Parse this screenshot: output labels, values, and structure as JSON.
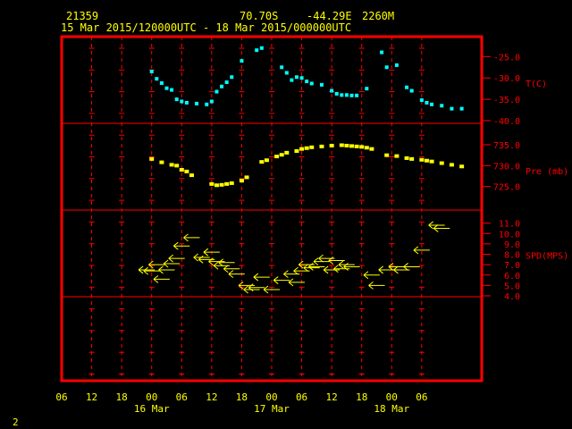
{
  "header": {
    "station_id": "21359",
    "lat": "70.70S",
    "lon": "-44.29E",
    "elevation": "2260M",
    "date_range": "15 Mar 2015/120000UTC - 18 Mar 2015/000000UTC"
  },
  "page_number": "2",
  "colors": {
    "frame": "#ff0000",
    "text": "#ffff00",
    "temp": "#00ffff",
    "pressure": "#ffff00",
    "wind": "#ffff00",
    "grid": "#ff0000",
    "axis_labels": "#ff0000"
  },
  "chart_data": [
    {
      "type": "scatter",
      "name": "T(C)",
      "ylabel": "T(C)",
      "ylim": [
        -40,
        -22
      ],
      "ticks": [
        "-25.0",
        "-30.0",
        "-35.0",
        "-40.0"
      ],
      "points": [
        [
          12,
          -28.5
        ],
        [
          13,
          -30.2
        ],
        [
          14,
          -31.2
        ],
        [
          15,
          -32.4
        ],
        [
          16,
          -32.8
        ],
        [
          17,
          -35.0
        ],
        [
          18,
          -35.5
        ],
        [
          19,
          -35.8
        ],
        [
          21,
          -36.0
        ],
        [
          23,
          -36.2
        ],
        [
          24,
          -35.5
        ],
        [
          25,
          -33.2
        ],
        [
          26,
          -32.0
        ],
        [
          27,
          -31.0
        ],
        [
          28,
          -29.8
        ],
        [
          30,
          -26.0
        ],
        [
          33,
          -23.5
        ],
        [
          34,
          -23.0
        ],
        [
          38,
          -27.5
        ],
        [
          39,
          -28.8
        ],
        [
          40,
          -30.5
        ],
        [
          41,
          -29.8
        ],
        [
          42,
          -30.0
        ],
        [
          43,
          -30.8
        ],
        [
          44,
          -31.3
        ],
        [
          46,
          -31.6
        ],
        [
          48,
          -33.0
        ],
        [
          49,
          -33.7
        ],
        [
          50,
          -34.0
        ],
        [
          51,
          -34.0
        ],
        [
          52,
          -34.1
        ],
        [
          53,
          -34.1
        ],
        [
          55,
          -32.5
        ],
        [
          58,
          -24.0
        ],
        [
          59,
          -27.5
        ],
        [
          61,
          -27.0
        ],
        [
          63,
          -32.2
        ],
        [
          64,
          -33.0
        ],
        [
          66,
          -35.2
        ],
        [
          67,
          -35.8
        ],
        [
          68,
          -36.2
        ],
        [
          70,
          -36.5
        ],
        [
          72,
          -37.2
        ],
        [
          74,
          -37.2
        ]
      ]
    },
    {
      "type": "scatter",
      "name": "Pre (mb)",
      "ylabel": "Pre (mb)",
      "ylim": [
        720,
        738
      ],
      "ticks": [
        "735.0",
        "730.0",
        "725.0"
      ],
      "points": [
        [
          12,
          731.6
        ],
        [
          14,
          730.8
        ],
        [
          16,
          730.2
        ],
        [
          17,
          730.0
        ],
        [
          18,
          729.0
        ],
        [
          19,
          728.6
        ],
        [
          20,
          727.7
        ],
        [
          24,
          725.6
        ],
        [
          25,
          725.3
        ],
        [
          26,
          725.4
        ],
        [
          27,
          725.6
        ],
        [
          28,
          725.8
        ],
        [
          30,
          726.4
        ],
        [
          31,
          727.2
        ],
        [
          34,
          730.9
        ],
        [
          35,
          731.3
        ],
        [
          37,
          732.2
        ],
        [
          38,
          732.6
        ],
        [
          39,
          733.1
        ],
        [
          41,
          733.5
        ],
        [
          42,
          734.0
        ],
        [
          43,
          734.2
        ],
        [
          44,
          734.4
        ],
        [
          46,
          734.6
        ],
        [
          48,
          734.8
        ],
        [
          50,
          734.9
        ],
        [
          51,
          734.8
        ],
        [
          52,
          734.7
        ],
        [
          53,
          734.6
        ],
        [
          54,
          734.5
        ],
        [
          55,
          734.3
        ],
        [
          56,
          734.0
        ],
        [
          59,
          732.5
        ],
        [
          61,
          732.3
        ],
        [
          63,
          731.8
        ],
        [
          64,
          731.6
        ],
        [
          66,
          731.4
        ],
        [
          67,
          731.2
        ],
        [
          68,
          731.0
        ],
        [
          70,
          730.6
        ],
        [
          72,
          730.2
        ],
        [
          74,
          729.8
        ]
      ]
    },
    {
      "type": "scatter",
      "name": "SPD(MPS)",
      "ylabel": "SPD(MPS)",
      "ylim": [
        4,
        12
      ],
      "ticks": [
        "11.0",
        "10.0",
        "9.0",
        "8.0",
        "7.0",
        "6.0",
        "5.0",
        "4.0"
      ],
      "points": [
        [
          11,
          6.5
        ],
        [
          12,
          6.4
        ],
        [
          13,
          7.0
        ],
        [
          14,
          5.6
        ],
        [
          15,
          6.5
        ],
        [
          16,
          7.1
        ],
        [
          17,
          7.6
        ],
        [
          18,
          8.8
        ],
        [
          20,
          9.6
        ],
        [
          22,
          7.7
        ],
        [
          23,
          7.5
        ],
        [
          24,
          8.2
        ],
        [
          25,
          7.3
        ],
        [
          26,
          6.9
        ],
        [
          27,
          7.2
        ],
        [
          28,
          6.6
        ],
        [
          29,
          6.1
        ],
        [
          31,
          5.0
        ],
        [
          32,
          4.6
        ],
        [
          33,
          4.8
        ],
        [
          34,
          5.8
        ],
        [
          36,
          4.6
        ],
        [
          38,
          5.5
        ],
        [
          40,
          6.1
        ],
        [
          41,
          5.3
        ],
        [
          42,
          6.4
        ],
        [
          43,
          7.0
        ],
        [
          44,
          6.7
        ],
        [
          45,
          6.8
        ],
        [
          46,
          7.3
        ],
        [
          47,
          7.6
        ],
        [
          48,
          6.5
        ],
        [
          49,
          7.4
        ],
        [
          50,
          6.6
        ],
        [
          51,
          7.0
        ],
        [
          52,
          6.8
        ],
        [
          56,
          6.0
        ],
        [
          57,
          5.0
        ],
        [
          59,
          6.5
        ],
        [
          61,
          6.8
        ],
        [
          62,
          6.5
        ],
        [
          64,
          6.8
        ],
        [
          66,
          8.4
        ],
        [
          69,
          10.8
        ],
        [
          70,
          10.5
        ]
      ]
    }
  ],
  "x_axis": {
    "xlim": [
      -6,
      78
    ],
    "ticks": [
      {
        "t": -6,
        "label": "06"
      },
      {
        "t": 0,
        "label": "12"
      },
      {
        "t": 6,
        "label": "18"
      },
      {
        "t": 12,
        "label": "00"
      },
      {
        "t": 18,
        "label": "06"
      },
      {
        "t": 24,
        "label": "12"
      },
      {
        "t": 30,
        "label": "18"
      },
      {
        "t": 36,
        "label": "00"
      },
      {
        "t": 42,
        "label": "06"
      },
      {
        "t": 48,
        "label": "12"
      },
      {
        "t": 54,
        "label": "18"
      },
      {
        "t": 60,
        "label": "00"
      },
      {
        "t": 66,
        "label": "06"
      }
    ],
    "day_labels": [
      {
        "t": 12,
        "label": "16 Mar"
      },
      {
        "t": 36,
        "label": "17 Mar"
      },
      {
        "t": 60,
        "label": "18 Mar"
      }
    ]
  }
}
